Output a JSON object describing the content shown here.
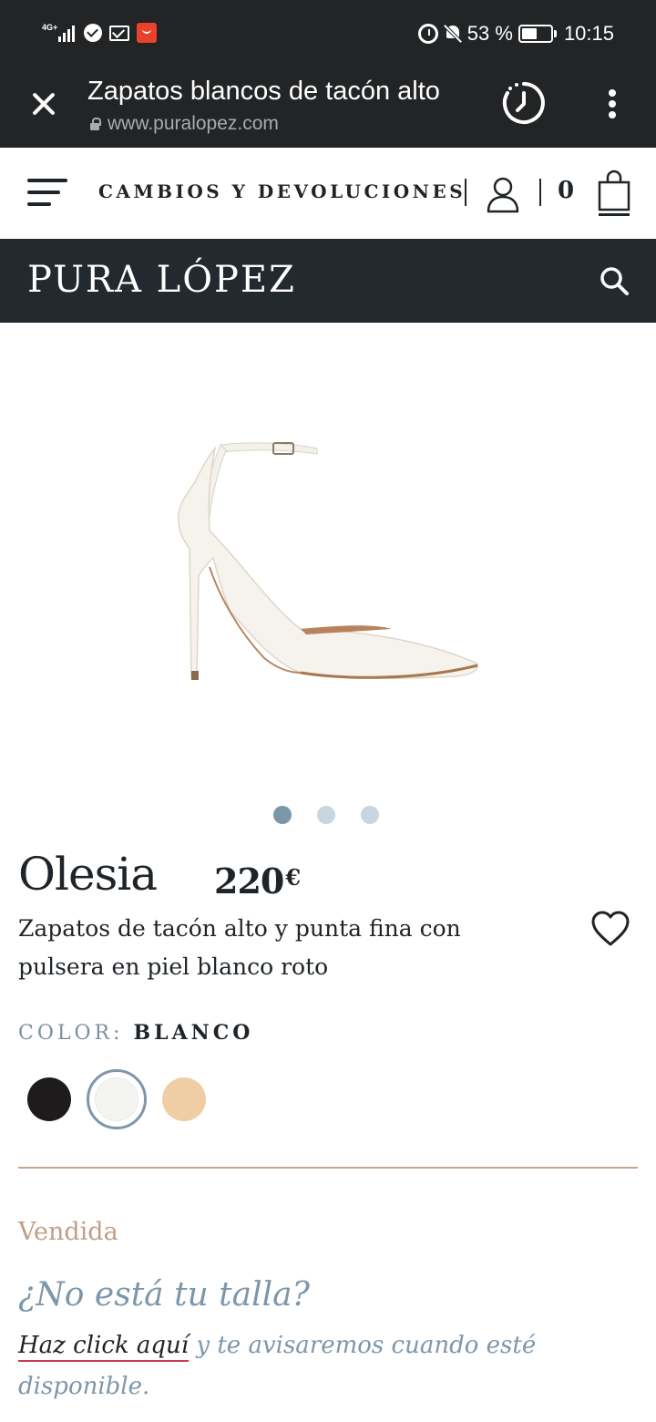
{
  "status_bar": {
    "network": "4G+",
    "battery": "53 %",
    "battery_level": 0.53,
    "time": "10:15",
    "icons": [
      "signal-icon",
      "check-circle-icon",
      "mail-icon",
      "app-notification-icon",
      "alarm-icon",
      "bell-muted-icon",
      "battery-icon"
    ]
  },
  "browser": {
    "page_title": "Zapatos blancos de tacón alto",
    "url": "www.puralopez.com"
  },
  "nav": {
    "returns_link": "CAMBIOS Y DEVOLUCIONES",
    "cart_count": "0"
  },
  "brand": {
    "logo": "PURA LÓPEZ"
  },
  "product": {
    "name": "Olesia",
    "price": "220",
    "currency": "€",
    "description": "Zapatos de tacón alto y punta fina con pulsera en piel blanco roto",
    "color_label": "COLOR:",
    "color_value": "BLANCO",
    "gallery_count": 3,
    "gallery_active": 1,
    "swatches": [
      {
        "name": "negro",
        "color": "#1d1b1b"
      },
      {
        "name": "blanco",
        "color": "#f4f4f0",
        "selected": true
      },
      {
        "name": "nude",
        "color": "#efcea6"
      }
    ]
  },
  "availability": {
    "status": "Vendida",
    "question": "¿No está tu talla?",
    "link_text": "Haz click aquí",
    "notify_text": " y te avisaremos cuando esté disponible."
  },
  "colors": {
    "dark_bar": "#222426",
    "brand_bar": "#222a30",
    "accent_blue": "#7d97aa",
    "accent_copper": "#c29d87"
  }
}
